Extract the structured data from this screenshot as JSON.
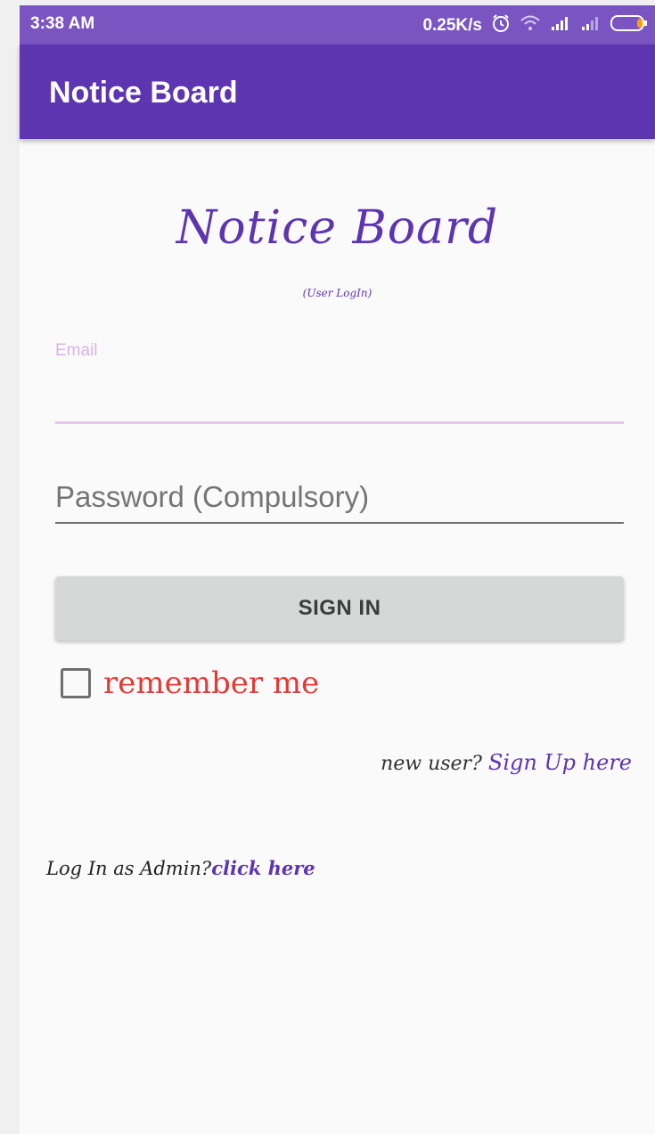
{
  "status_bar": {
    "time": "3:38 AM",
    "net_speed": "0.25K/s",
    "icons": [
      "alarm-icon",
      "wifi-icon",
      "signal-icon",
      "signal-icon",
      "battery-icon"
    ]
  },
  "app_bar": {
    "title": "Notice Board"
  },
  "logo": {
    "title": "Notice Board",
    "subtitle": "(User LogIn)"
  },
  "form": {
    "email_label": "Email",
    "email_value": "",
    "password_placeholder": "Password (Compulsory)",
    "password_value": "",
    "signin_label": "SIGN IN",
    "remember_label": "remember me",
    "remember_checked": false
  },
  "links": {
    "new_user_text": "new user?",
    "signup_link": "Sign Up here",
    "admin_text": "Log In as Admin?",
    "admin_link": "click here"
  },
  "colors": {
    "primary": "#5e35b1",
    "status_bar": "#7a55c2",
    "accent_red": "#e53935",
    "email_focus": "#e6c6ee"
  }
}
